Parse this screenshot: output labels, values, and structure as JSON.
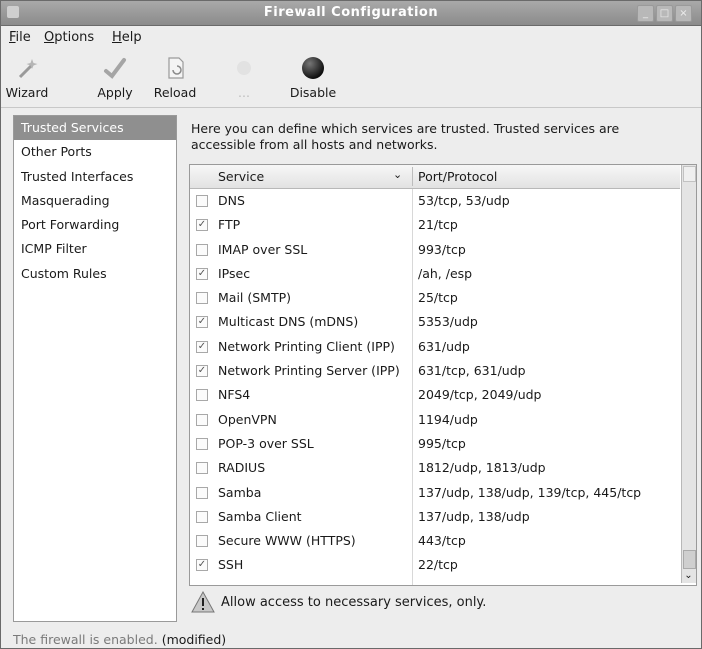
{
  "window": {
    "title": "Firewall Configuration"
  },
  "menu": {
    "file": "File",
    "options": "Options",
    "help": "Help"
  },
  "toolbar": {
    "wizard": "Wizard",
    "apply": "Apply",
    "reload": "Reload",
    "disabled_item": "...",
    "disable": "Disable"
  },
  "sidebar": {
    "items": [
      {
        "label": "Trusted Services"
      },
      {
        "label": "Other Ports"
      },
      {
        "label": "Trusted Interfaces"
      },
      {
        "label": "Masquerading"
      },
      {
        "label": "Port Forwarding"
      },
      {
        "label": "ICMP Filter"
      },
      {
        "label": "Custom Rules"
      }
    ]
  },
  "main": {
    "description": "Here you can define which services are trusted. Trusted services are accessible from all hosts and networks.",
    "columns": {
      "service": "Service",
      "port": "Port/Protocol"
    },
    "rows": [
      {
        "service": "DNS",
        "port": "53/tcp, 53/udp",
        "checked": false
      },
      {
        "service": "FTP",
        "port": "21/tcp",
        "checked": true
      },
      {
        "service": "IMAP over SSL",
        "port": "993/tcp",
        "checked": false
      },
      {
        "service": "IPsec",
        "port": "/ah, /esp",
        "checked": true
      },
      {
        "service": "Mail (SMTP)",
        "port": "25/tcp",
        "checked": false
      },
      {
        "service": "Multicast DNS (mDNS)",
        "port": "5353/udp",
        "checked": true
      },
      {
        "service": "Network Printing Client (IPP)",
        "port": "631/udp",
        "checked": true
      },
      {
        "service": "Network Printing Server (IPP)",
        "port": "631/tcp, 631/udp",
        "checked": true
      },
      {
        "service": "NFS4",
        "port": "2049/tcp, 2049/udp",
        "checked": false
      },
      {
        "service": "OpenVPN",
        "port": "1194/udp",
        "checked": false
      },
      {
        "service": "POP-3 over SSL",
        "port": "995/tcp",
        "checked": false
      },
      {
        "service": "RADIUS",
        "port": "1812/udp, 1813/udp",
        "checked": false
      },
      {
        "service": "Samba",
        "port": "137/udp, 138/udp, 139/tcp, 445/tcp",
        "checked": false
      },
      {
        "service": "Samba Client",
        "port": "137/udp, 138/udp",
        "checked": false
      },
      {
        "service": "Secure WWW (HTTPS)",
        "port": "443/tcp",
        "checked": false
      },
      {
        "service": "SSH",
        "port": "22/tcp",
        "checked": true
      }
    ],
    "warning": "Allow access to necessary services, only."
  },
  "status": {
    "text": "The firewall is enabled.",
    "modified": "(modified)"
  }
}
